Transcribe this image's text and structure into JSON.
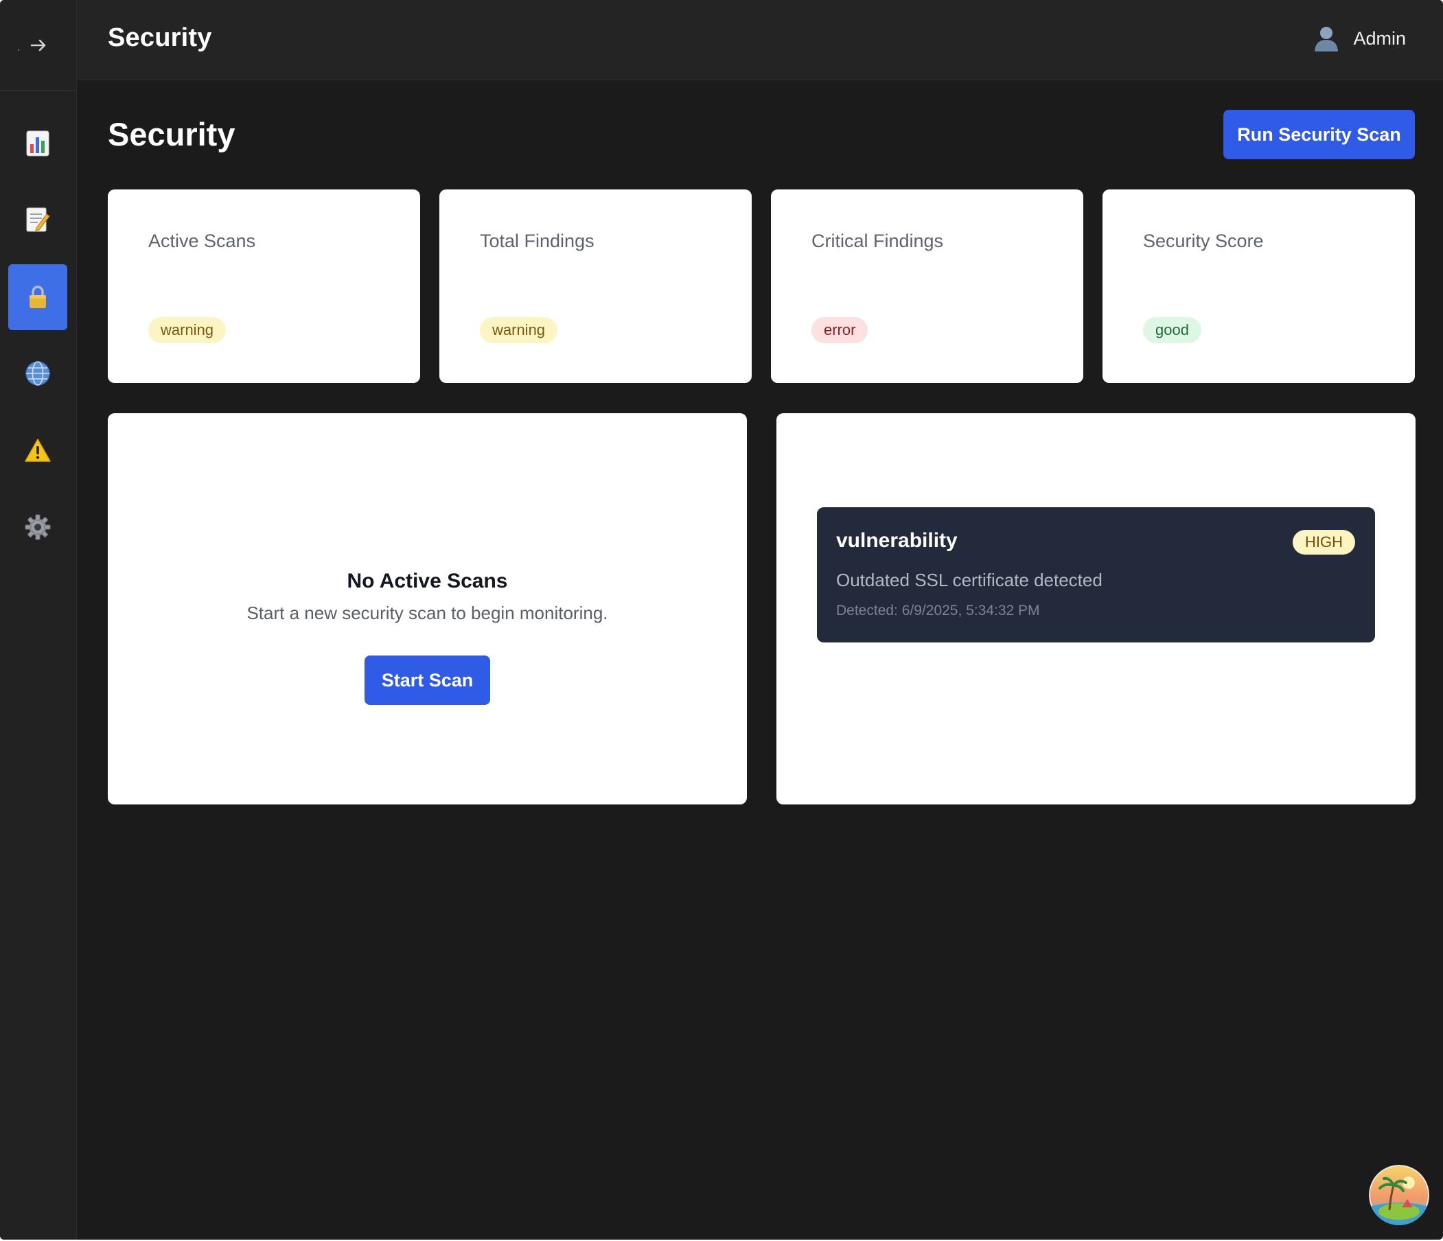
{
  "header": {
    "title": "Security",
    "user_name": "Admin"
  },
  "sidebar": {
    "items": [
      {
        "id": "dashboard",
        "icon": "bar-chart-icon",
        "active": false
      },
      {
        "id": "notes",
        "icon": "memo-icon",
        "active": false
      },
      {
        "id": "security",
        "icon": "lock-icon",
        "active": true
      },
      {
        "id": "network",
        "icon": "globe-icon",
        "active": false
      },
      {
        "id": "alerts",
        "icon": "warning-icon",
        "active": false
      },
      {
        "id": "settings",
        "icon": "gear-icon",
        "active": false
      }
    ]
  },
  "main": {
    "page_title": "Security",
    "run_scan_label": "Run Security Scan",
    "stats": [
      {
        "label": "Active Scans",
        "status": "warning"
      },
      {
        "label": "Total Findings",
        "status": "warning"
      },
      {
        "label": "Critical Findings",
        "status": "error"
      },
      {
        "label": "Security Score",
        "status": "good"
      }
    ],
    "scans_panel": {
      "empty_title": "No Active Scans",
      "empty_description": "Start a new security scan to begin monitoring.",
      "start_label": "Start Scan"
    },
    "findings": [
      {
        "type": "vulnerability",
        "severity": "HIGH",
        "description": "Outdated SSL certificate detected",
        "detected": "Detected: 6/9/2025, 5:34:32 PM"
      }
    ]
  },
  "colors": {
    "accent": "#2f5be6",
    "sidebar_active": "#3f6fe6",
    "background": "#1b1b1c",
    "card": "#ffffff",
    "finding_card": "#222a3b"
  }
}
